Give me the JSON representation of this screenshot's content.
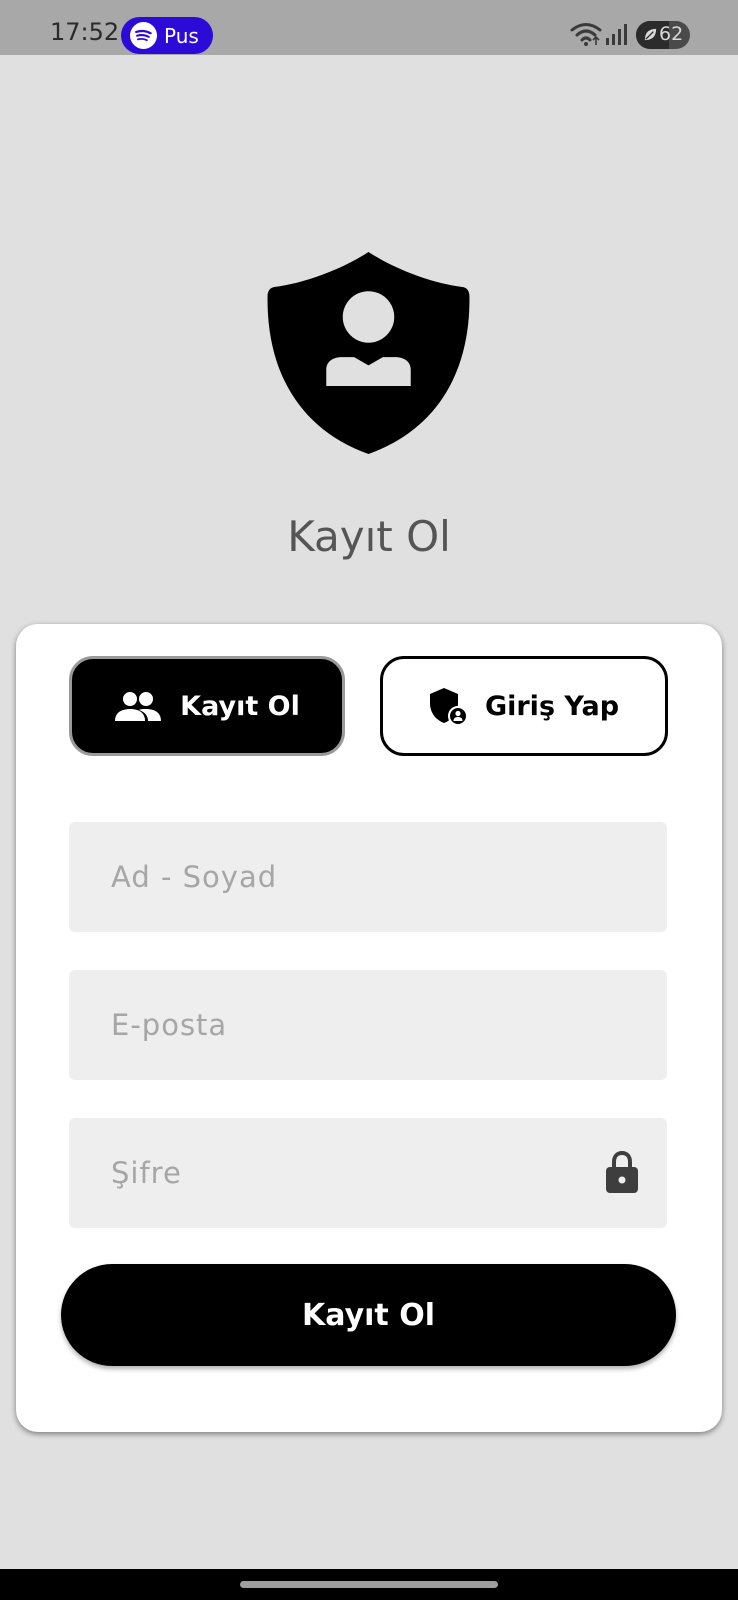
{
  "status_bar": {
    "time": "17:52",
    "media_app_label": "Pus",
    "battery_percent": "62",
    "battery_level": 0.62,
    "icons": [
      "spotify-icon",
      "wifi-icon",
      "signal-icon",
      "battery-icon"
    ]
  },
  "hero": {
    "logo_icon": "shield-user-icon",
    "title": "Kayıt Ol"
  },
  "tabs": {
    "register": {
      "label": "Kayıt Ol",
      "icon": "people-icon",
      "active": true
    },
    "login": {
      "label": "Giriş Yap",
      "icon": "shield-user-icon",
      "active": false
    }
  },
  "form": {
    "name": {
      "placeholder": "Ad - Soyad",
      "value": ""
    },
    "email": {
      "placeholder": "E-posta",
      "value": ""
    },
    "password": {
      "placeholder": "Şifre",
      "value": "",
      "icon": "lock-icon"
    },
    "submit_label": "Kayıt Ol"
  },
  "colors": {
    "background": "#e0e0e0",
    "card": "#ffffff",
    "primary": "#000000",
    "field_background": "#eeeeee",
    "spotify_pill": "#2c0bd9"
  }
}
